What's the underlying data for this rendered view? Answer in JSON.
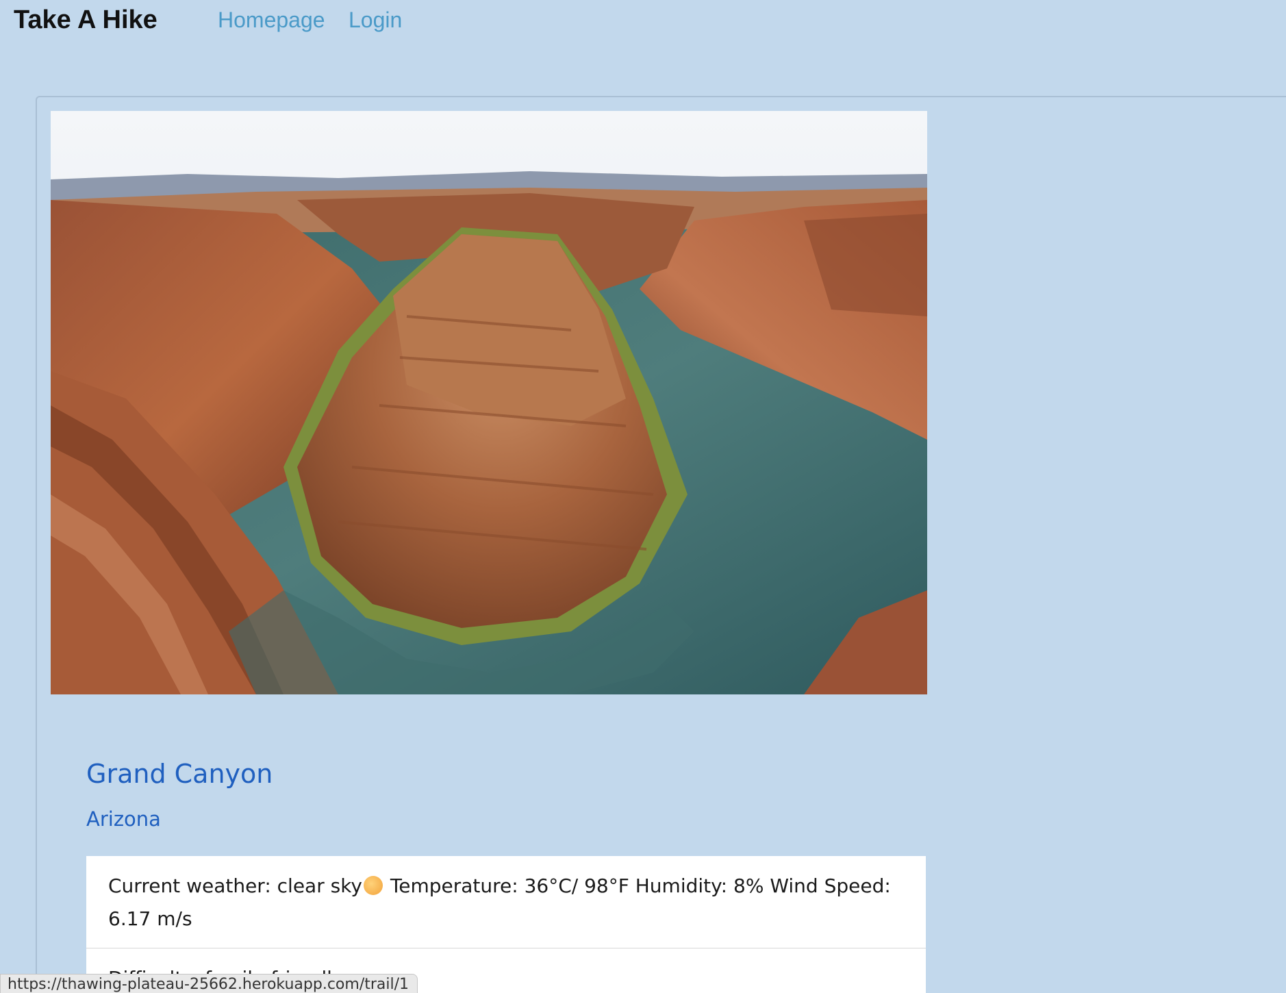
{
  "navbar": {
    "brand": "Take A Hike",
    "links": [
      {
        "label": "Homepage"
      },
      {
        "label": "Login"
      }
    ]
  },
  "trail": {
    "image_alt": "Horseshoe bend canyon",
    "name": "Grand Canyon",
    "state": "Arizona",
    "details": [
      {
        "prefix": "Current weather: clear sky",
        "icon": "sun-icon",
        "suffix": " Temperature: 36°C/ 98°F Humidity: 8% Wind Speed: 6.17 m/s"
      },
      {
        "text": "Difficulty: family-friendly"
      }
    ]
  },
  "status_bar": {
    "url": "https://thawing-plateau-25662.herokuapp.com/trail/1"
  },
  "colors": {
    "page_bg": "#c2d8ec",
    "link": "#4a9ac8",
    "title": "#1f5fbf"
  }
}
